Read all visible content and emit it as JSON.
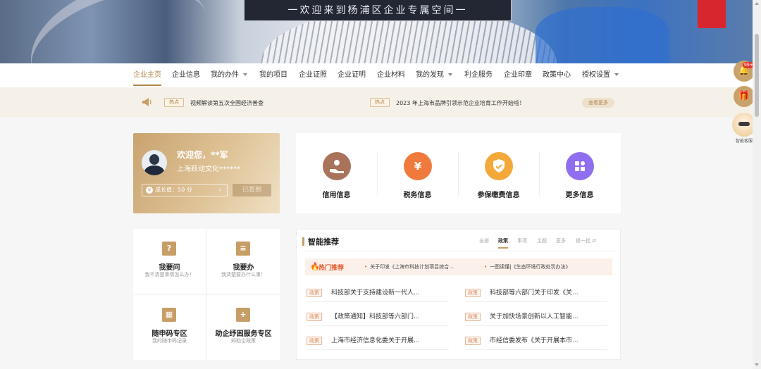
{
  "banner": {
    "title": "一欢迎来到杨浦区企业专属空间一"
  },
  "nav": {
    "items": [
      {
        "label": "企业主页",
        "active": true
      },
      {
        "label": "企业信息"
      },
      {
        "label": "我的办件",
        "dropdown": true
      },
      {
        "label": "我的项目"
      },
      {
        "label": "企业证照"
      },
      {
        "label": "企业证明"
      },
      {
        "label": "企业材料"
      },
      {
        "label": "我的发现",
        "dropdown": true
      },
      {
        "label": "利企服务"
      },
      {
        "label": "企业印章"
      },
      {
        "label": "政策中心"
      },
      {
        "label": "授权设置",
        "dropdown": true
      }
    ]
  },
  "news": {
    "items": [
      {
        "tag": "热点",
        "text": "视频解读第五次全国经济普查"
      },
      {
        "tag": "热点",
        "text": "2023 年上海市品牌引领示范企业培育工作开始啦！"
      }
    ],
    "more_label": "查看更多"
  },
  "welcome": {
    "greeting": "欢迎您，**军",
    "company": "上海跃动文化******",
    "growth": "成长值：50 分",
    "signed": "已签到"
  },
  "info": {
    "items": [
      {
        "label": "信用信息",
        "icon": "hand-icon",
        "color": "#a8735a"
      },
      {
        "label": "税务信息",
        "icon": "yen-bag-icon",
        "color": "#f07a3c"
      },
      {
        "label": "参保缴费信息",
        "icon": "shield-icon",
        "color": "#f3a93a"
      },
      {
        "label": "更多信息",
        "icon": "grid-icon",
        "color": "#8f6ff0"
      }
    ]
  },
  "tiles": [
    {
      "title": "我要问",
      "subtitle": "我不清楚事情怎么办！",
      "icon": "question-box-icon"
    },
    {
      "title": "我要办",
      "subtitle": "我清楚要办什么事！",
      "icon": "clipboard-icon"
    },
    {
      "title": "随申码专区",
      "subtitle": "我的随申码记录",
      "icon": "qrcode-icon"
    },
    {
      "title": "助企纾困服务专区",
      "subtitle": "知助企政策",
      "icon": "medical-box-icon"
    }
  ],
  "recommend": {
    "title": "智能推荐",
    "tabs": [
      "全部",
      "政策",
      "事项",
      "主题",
      "更多",
      "换一批"
    ],
    "hot_label": "热门推荐",
    "hot_items": [
      "关于印发《上海市科技计划项目综合...",
      "一图读懂|《生态环境行政处罚办法》"
    ],
    "policies": [
      {
        "tag": "政策",
        "text": "科技部关于支持建设新一代人..."
      },
      {
        "tag": "政策",
        "text": "科技部等六部门关于印发《关..."
      },
      {
        "tag": "政策",
        "text": "【政策通知】科技部等六部门..."
      },
      {
        "tag": "政策",
        "text": "关于加快场景创新以人工智能..."
      },
      {
        "tag": "政策",
        "text": "上海市经济信息化委关于开展..."
      },
      {
        "tag": "政策",
        "text": "市经信委发布《关于开展本市..."
      }
    ]
  },
  "float": {
    "badge": "99+",
    "assistant_label": "智能客服"
  }
}
